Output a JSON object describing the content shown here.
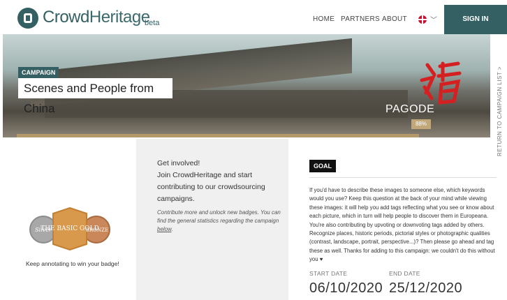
{
  "header": {
    "logo_text_crowd": "Crowd",
    "logo_text_heritage": "Heritage",
    "beta": "beta",
    "nav": [
      "HOME",
      "PARTNERS",
      "ABOUT"
    ],
    "language_icon": "uk-flag-icon",
    "signin": "SIGN IN"
  },
  "banner": {
    "tag": "CAMPAIGN",
    "title": "Scenes and People from China",
    "topic": "PAGODE",
    "progress_label": "88%",
    "progress_value": 88,
    "side_link": "RETURN TO CAMPAIGN LIST  >"
  },
  "badges": {
    "labels": [
      "Silver",
      "THE BASIC GOLD",
      "BRONZE"
    ],
    "caption": "Keep annotating to win your badge!"
  },
  "involve": {
    "line1": "Get involved!",
    "line2": "Join CrowdHeritage and start contributing to our crowdsourcing campaigns.",
    "more": "Contribute more and unlock new badges. You can find the general statistics regarding the campaign ",
    "link": "below",
    "after_link": "."
  },
  "goal": {
    "tag": "GOAL",
    "text": "If you'd have to describe these images to someone else, which keywords would you use? Keep this question at the back of your mind while viewing these images: it will help you add tags reflecting what you see or know about each picture, which in turn will help people to discover them in Europeana. You're also contributing by upvoting or downvoting tags added by others. Recognize places, historic periods, pictorial styles or photographic qualities (contrast, landscape, portrait, perspective...)? Then please go ahead and tag these as well. Thanks for adding to this campaign: we couldn't do this without you ♥"
  },
  "dates": {
    "start_label": "START DATE",
    "start": "06/10/2020",
    "end_label": "END DATE",
    "end": "25/12/2020"
  }
}
